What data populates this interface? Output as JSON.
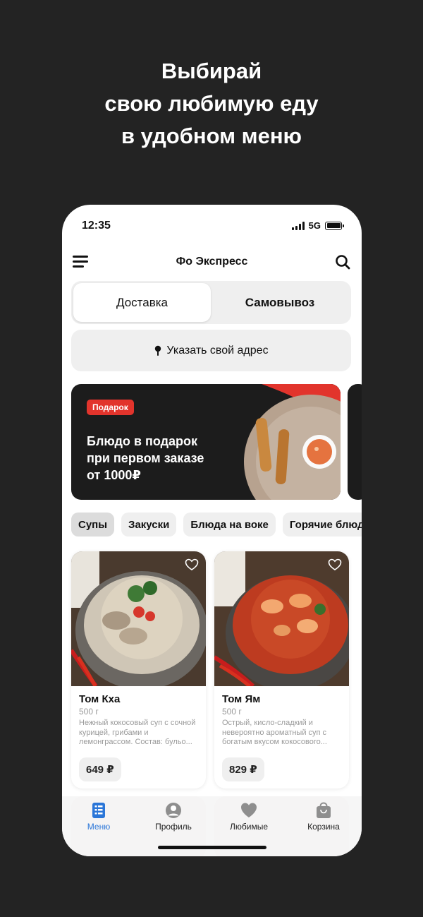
{
  "promo": {
    "line1": "Выбирай",
    "line2": "свою любимую еду",
    "line3": "в удобном меню"
  },
  "status_bar": {
    "time": "12:35",
    "network": "5G"
  },
  "header": {
    "title": "Фо Экспресс",
    "menu_icon": "hamburger-icon",
    "search_icon": "search-icon"
  },
  "delivery_toggle": {
    "options": [
      "Доставка",
      "Самовывоз"
    ],
    "selected": "Доставка"
  },
  "address": {
    "label": "Указать свой адрес",
    "icon": "location-pin-icon"
  },
  "banner": {
    "tag": "Подарок",
    "line1": "Блюдо в подарок",
    "line2": "при первом заказе",
    "line3": "от 1000₽",
    "tag_color": "#e2342c"
  },
  "categories": [
    {
      "label": "Супы",
      "active": true
    },
    {
      "label": "Закуски",
      "active": false
    },
    {
      "label": "Блюда на воке",
      "active": false
    },
    {
      "label": "Горячие блюда",
      "active": false
    }
  ],
  "products": [
    {
      "name": "Том Кха",
      "weight": "500 г",
      "description": "Нежный кокосовый суп с сочной курицей, грибами и лемонграссом. Состав: бульо...",
      "price": "649 ₽"
    },
    {
      "name": "Том Ям",
      "weight": "500 г",
      "description": "Острый, кисло-сладкий и невероятно ароматный суп с богатым вкусом кокосового...",
      "price": "829 ₽"
    }
  ],
  "tabbar": {
    "tabs": [
      {
        "label": "Меню",
        "icon": "menu-list-icon",
        "active": true
      },
      {
        "label": "Профиль",
        "icon": "profile-icon",
        "active": false
      },
      {
        "label": "Любимые",
        "icon": "heart-icon",
        "active": false
      },
      {
        "label": "Корзина",
        "icon": "cart-icon",
        "active": false
      }
    ],
    "active_color": "#2b76d8"
  },
  "colors": {
    "background": "#232323",
    "surface": "#efefef",
    "accent": "#2b76d8"
  }
}
